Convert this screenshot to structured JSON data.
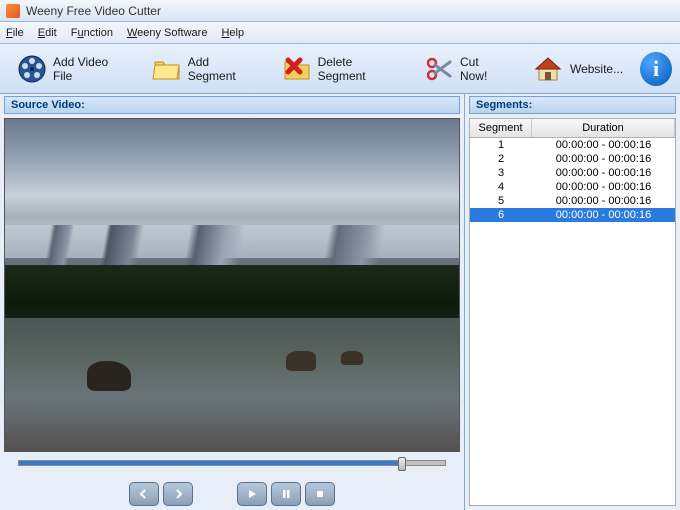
{
  "app": {
    "title": "Weeny Free Video Cutter"
  },
  "menu": {
    "file": "File",
    "edit": "Edit",
    "function": "Function",
    "weeny": "Weeny Software",
    "help": "Help"
  },
  "toolbar": {
    "add_video": "Add Video File",
    "add_segment": "Add Segment",
    "delete_segment": "Delete Segment",
    "cut_now": "Cut Now!",
    "website": "Website..."
  },
  "panels": {
    "source_video": "Source Video:",
    "segments": "Segments:"
  },
  "segments": {
    "col_segment": "Segment",
    "col_duration": "Duration",
    "rows": [
      {
        "id": "1",
        "duration": "00:00:00 - 00:00:16",
        "selected": false
      },
      {
        "id": "2",
        "duration": "00:00:00 - 00:00:16",
        "selected": false
      },
      {
        "id": "3",
        "duration": "00:00:00 - 00:00:16",
        "selected": false
      },
      {
        "id": "4",
        "duration": "00:00:00 - 00:00:16",
        "selected": false
      },
      {
        "id": "5",
        "duration": "00:00:00 - 00:00:16",
        "selected": false
      },
      {
        "id": "6",
        "duration": "00:00:00 - 00:00:16",
        "selected": true
      }
    ]
  },
  "timeline": {
    "position_percent": 90
  },
  "icons": {
    "reel": "film-reel-icon",
    "folder": "folder-icon",
    "delete": "delete-x-icon",
    "scissors": "scissors-icon",
    "house": "house-icon",
    "info": "info-icon"
  }
}
